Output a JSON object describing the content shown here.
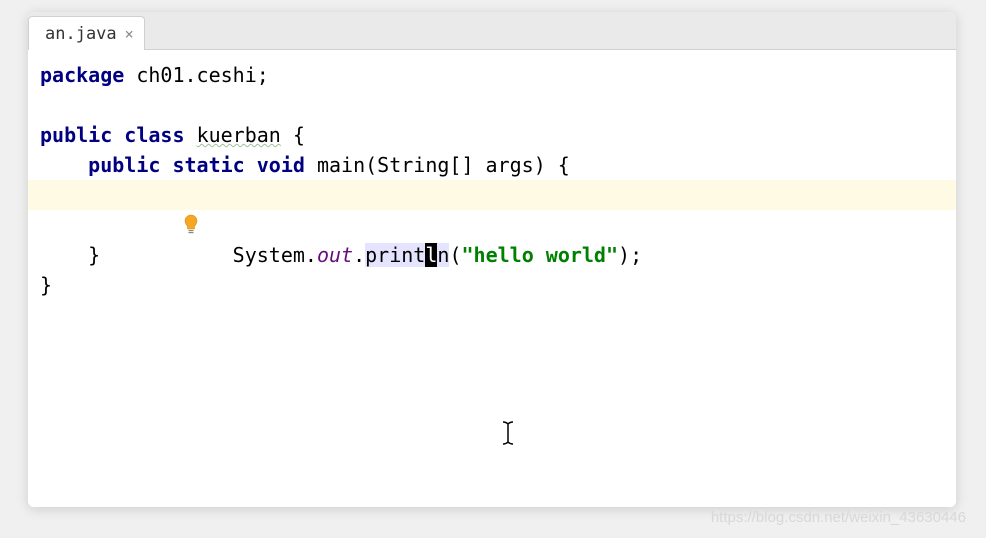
{
  "tab": {
    "filename": "an.java"
  },
  "code": {
    "line1": {
      "kw_package": "package",
      "pkg_name": " ch01.ceshi;"
    },
    "line3": {
      "kw_public": "public",
      "kw_class": "class",
      "class_name_wavy": "kuerban",
      "brace": " {"
    },
    "line4": {
      "indent": "    ",
      "kw_public": "public",
      "kw_static": "static",
      "kw_void": "void",
      "method_sig": " main(String[] args) {"
    },
    "line5": {
      "indent": "        ",
      "sys": "System.",
      "out_field": "out",
      "dot": ".",
      "method_pre": "print",
      "caret_char": "l",
      "method_post": "n",
      "paren_open": "(",
      "string_lit": "\"hello world\"",
      "paren_close": ");"
    },
    "line7": {
      "indent": "    ",
      "brace": "}"
    },
    "line8": {
      "brace": "}"
    }
  },
  "watermark": "https://blog.csdn.net/weixin_43630446"
}
